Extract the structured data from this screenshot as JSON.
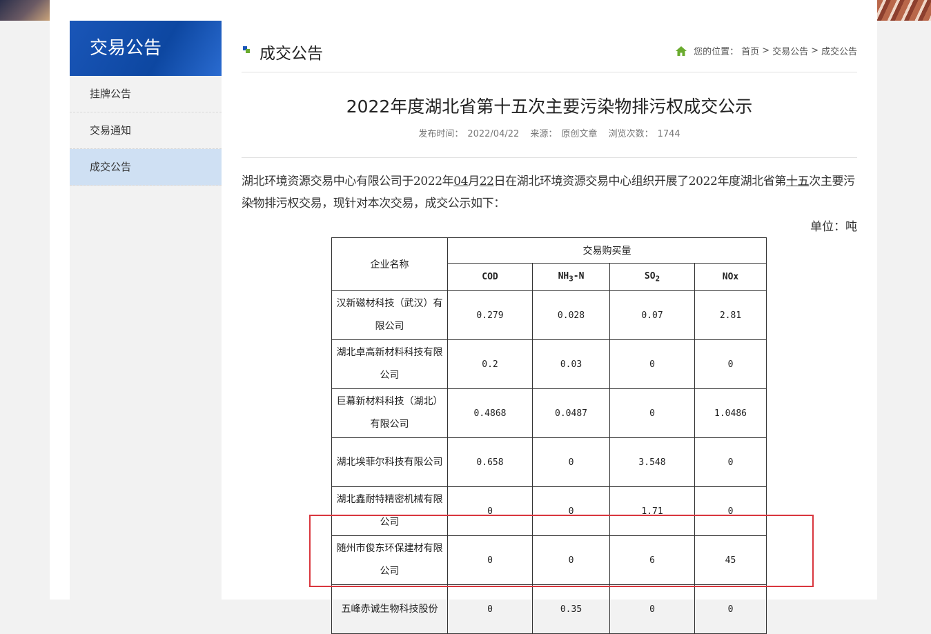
{
  "sidebar": {
    "title": "交易公告",
    "items": [
      {
        "label": "挂牌公告"
      },
      {
        "label": "交易通知"
      },
      {
        "label": "成交公告"
      }
    ]
  },
  "section": {
    "title": "成交公告",
    "breadcrumb": {
      "prefix": "您的位置：",
      "items": [
        "首页",
        "交易公告",
        "成交公告"
      ],
      "separator": ">"
    }
  },
  "article": {
    "title": "2022年度湖北省第十五次主要污染物排污权成交公示",
    "meta": {
      "publish_label": "发布时间：",
      "publish_date": "2022/04/22",
      "source_label": "来源：",
      "source": "原创文章",
      "views_label": "浏览次数：",
      "views": "1744"
    },
    "intro": {
      "part1": "湖北环境资源交易中心有限公司于2022年",
      "month": "04",
      "part2": "月",
      "day": "22",
      "part3": "日在湖北环境资源交易中心组织开展了2022年度湖北省第",
      "num_a": "十",
      "num_b": "五",
      "part4": "次主要污染物排污权交易，现针对本次交易，成交公示如下："
    },
    "unit": "单位：吨"
  },
  "table": {
    "name_header": "企业名称",
    "group_header": "交易购买量",
    "col_cod": "COD",
    "col_nh3_a": "NH",
    "col_nh3_sub": "3",
    "col_nh3_b": "-N",
    "col_so2_a": "SO",
    "col_so2_sub": "2",
    "col_nox": "NOx",
    "rows": [
      {
        "name": "汉新磁材科技（武汉）有限公司",
        "cod": "0.279",
        "nh3n": "0.028",
        "so2": "0.07",
        "nox": "2.81"
      },
      {
        "name": "湖北卓高新材料科技有限公司",
        "cod": "0.2",
        "nh3n": "0.03",
        "so2": "0",
        "nox": "0"
      },
      {
        "name": "巨幕新材料科技（湖北）有限公司",
        "cod": "0.4868",
        "nh3n": "0.0487",
        "so2": "0",
        "nox": "1.0486"
      },
      {
        "name": "湖北埃菲尔科技有限公司",
        "cod": "0.658",
        "nh3n": "0",
        "so2": "3.548",
        "nox": "0"
      },
      {
        "name": "湖北鑫耐特精密机械有限公司",
        "cod": "0",
        "nh3n": "0",
        "so2": "1.71",
        "nox": "0"
      },
      {
        "name": "随州市俊东环保建材有限公司",
        "cod": "0",
        "nh3n": "0",
        "so2": "6",
        "nox": "45"
      },
      {
        "name": "五峰赤诚生物科技股份",
        "cod": "0",
        "nh3n": "0.35",
        "so2": "0",
        "nox": "0"
      }
    ]
  },
  "colors": {
    "sidebar_header": "#0d47a1",
    "sidebar_active": "#cfe0f3",
    "highlight_box": "#d9363e",
    "home_icon": "#6aab2e"
  }
}
